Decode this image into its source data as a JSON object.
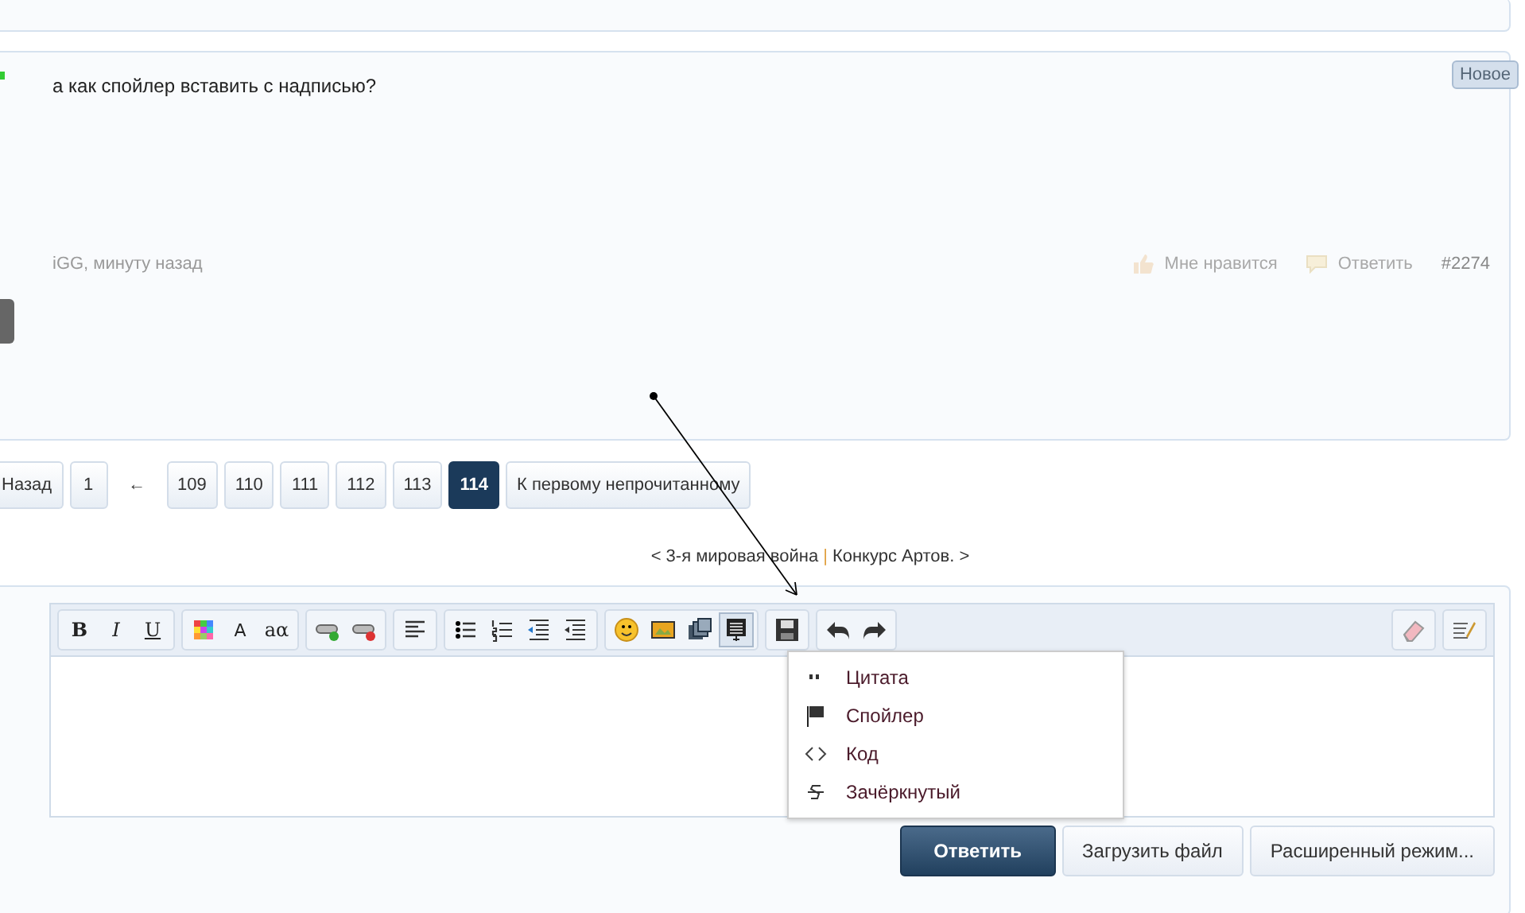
{
  "post": {
    "message": "а как спойлер вставить с надписью?",
    "meta": "iGG, минуту назад",
    "like": "Мне нравится",
    "reply": "Ответить",
    "number": "#2274",
    "is_new": true,
    "new_label": "Новое"
  },
  "pagination": {
    "prev": "Назад",
    "pages": [
      {
        "label": "1",
        "kind": "page",
        "selected": false
      },
      {
        "label": "←",
        "kind": "gap",
        "selected": false
      },
      {
        "label": "109",
        "kind": "page",
        "selected": false
      },
      {
        "label": "110",
        "kind": "page",
        "selected": false
      },
      {
        "label": "111",
        "kind": "page",
        "selected": false
      },
      {
        "label": "112",
        "kind": "page",
        "selected": false
      },
      {
        "label": "113",
        "kind": "page",
        "selected": false
      },
      {
        "label": "114",
        "kind": "page",
        "selected": true
      }
    ],
    "unread": "К первому непрочитанному"
  },
  "thread_nav": {
    "prev": "< 3-я мировая война",
    "sep": "|",
    "next": "Конкурс Артов. >"
  },
  "toolbar": {
    "left": [
      [
        {
          "kind": "bold",
          "label": "B",
          "active": false
        },
        {
          "kind": "italic",
          "label": "I",
          "active": false
        },
        {
          "kind": "underline",
          "label": "U",
          "active": false
        }
      ],
      [
        {
          "kind": "color",
          "active": false
        },
        {
          "kind": "size",
          "label": "A",
          "active": false
        },
        {
          "kind": "font",
          "label": "aα",
          "active": false
        }
      ],
      [
        {
          "kind": "link",
          "active": false
        },
        {
          "kind": "unlink",
          "active": false
        }
      ],
      [
        {
          "kind": "align",
          "active": false
        }
      ],
      [
        {
          "kind": "bullets",
          "active": false
        },
        {
          "kind": "numbers",
          "active": false
        },
        {
          "kind": "outdent",
          "active": false
        },
        {
          "kind": "indent",
          "active": false
        }
      ],
      [
        {
          "kind": "smiley",
          "active": false
        },
        {
          "kind": "image",
          "active": false
        },
        {
          "kind": "media",
          "active": false
        },
        {
          "kind": "insert",
          "active": true
        }
      ],
      [
        {
          "kind": "save",
          "active": false
        }
      ],
      [
        {
          "kind": "undo",
          "active": false
        },
        {
          "kind": "redo",
          "active": false
        }
      ]
    ],
    "right": [
      {
        "kind": "eraser",
        "active": false
      },
      {
        "kind": "source",
        "active": false
      }
    ]
  },
  "dropdown": [
    {
      "kind": "quote",
      "label": "Цитата"
    },
    {
      "kind": "flag",
      "label": "Спойлер"
    },
    {
      "kind": "code",
      "label": "Код"
    },
    {
      "kind": "strike",
      "label": "Зачёркнутый"
    }
  ],
  "actions": [
    {
      "label": "Ответить",
      "kind": "primary"
    },
    {
      "label": "Загрузить файл",
      "kind": "secondary"
    },
    {
      "label": "Расширенный режим...",
      "kind": "secondary"
    }
  ]
}
